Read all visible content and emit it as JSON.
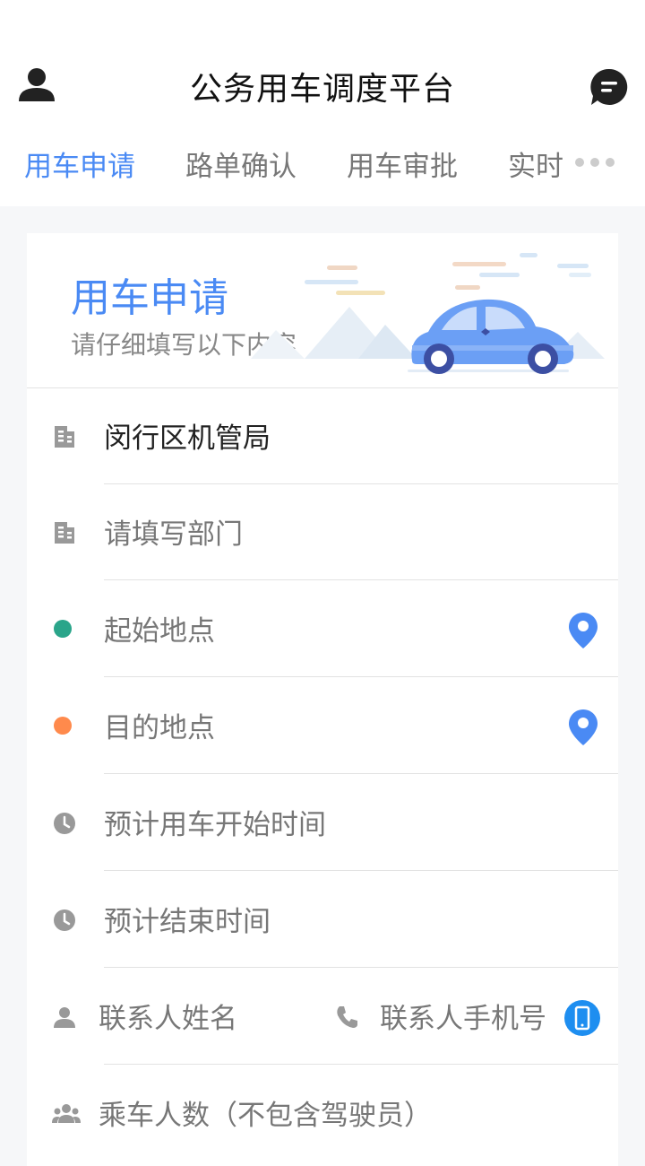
{
  "header": {
    "title": "公务用车调度平台",
    "tabs": [
      {
        "label": "用车申请",
        "active": true
      },
      {
        "label": "路单确认",
        "active": false
      },
      {
        "label": "用车审批",
        "active": false
      },
      {
        "label": "实时",
        "active": false
      }
    ]
  },
  "hero": {
    "title": "用车申请",
    "subtitle": "请仔细填写以下内容"
  },
  "form": {
    "organization": "闵行区机管局",
    "department_placeholder": "请填写部门",
    "start_location_placeholder": "起始地点",
    "destination_placeholder": "目的地点",
    "start_time_placeholder": "预计用车开始时间",
    "end_time_placeholder": "预计结束时间",
    "contact_name_placeholder": "联系人姓名",
    "contact_phone_placeholder": "联系人手机号",
    "passengers_placeholder": "乘车人数（不包含驾驶员）"
  },
  "colors": {
    "accent": "#4a8af4",
    "start_dot": "#2aa58a",
    "destination_dot": "#ff8a4c",
    "location_pin": "#4a8af4",
    "mobile_badge": "#1e8ef0"
  }
}
